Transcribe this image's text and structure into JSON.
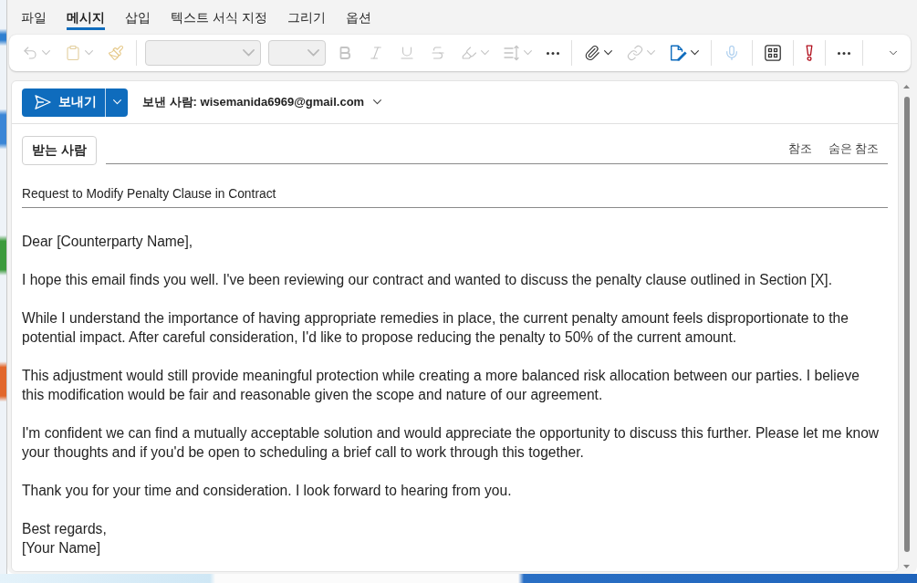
{
  "menu_tabs": [
    {
      "label": "파일",
      "selected": false
    },
    {
      "label": "메시지",
      "selected": true
    },
    {
      "label": "삽입",
      "selected": false
    },
    {
      "label": "텍스트 서식 지정",
      "selected": false
    },
    {
      "label": "그리기",
      "selected": false
    },
    {
      "label": "옵션",
      "selected": false
    }
  ],
  "toolbar": [
    {
      "kind": "undo",
      "disabled": true,
      "dropdown": true
    },
    {
      "kind": "paste",
      "disabled": true,
      "dropdown": true
    },
    {
      "kind": "format-painter",
      "disabled": true
    },
    {
      "kind": "separator"
    },
    {
      "kind": "font-field",
      "disabled": true
    },
    {
      "kind": "size-field",
      "disabled": true
    },
    {
      "kind": "bold",
      "disabled": true
    },
    {
      "kind": "italic",
      "disabled": true
    },
    {
      "kind": "underline",
      "disabled": true
    },
    {
      "kind": "strikethrough",
      "disabled": true
    },
    {
      "kind": "highlight",
      "disabled": true,
      "dropdown": true
    },
    {
      "kind": "line-spacing",
      "disabled": true,
      "dropdown": true
    },
    {
      "kind": "more",
      "disabled": false
    },
    {
      "kind": "separator"
    },
    {
      "kind": "attach",
      "disabled": false,
      "dropdown": true
    },
    {
      "kind": "link",
      "disabled": true,
      "dropdown": true
    },
    {
      "kind": "signature",
      "disabled": false,
      "dropdown": true
    },
    {
      "kind": "separator"
    },
    {
      "kind": "dictate",
      "disabled": true
    },
    {
      "kind": "separator"
    },
    {
      "kind": "apps",
      "disabled": false
    },
    {
      "kind": "separator"
    },
    {
      "kind": "importance",
      "disabled": false
    },
    {
      "kind": "separator"
    },
    {
      "kind": "more",
      "disabled": false
    },
    {
      "kind": "separator"
    },
    {
      "kind": "expand",
      "disabled": false
    }
  ],
  "compose": {
    "send_button": {
      "label": "보내기"
    },
    "from": "보낸 사람: wisemanida6969@gmail.com",
    "to_button": {
      "label": "받는 사람"
    },
    "cc_link": "참조",
    "bcc_link": "숨은 참조",
    "subject": "Request to Modify Penalty Clause in Contract",
    "body": [
      {
        "lines": [
          "Dear [Counterparty Name],"
        ]
      },
      {
        "lines": [
          "I hope this email finds you well. I've been reviewing our contract and wanted to discuss the penalty clause outlined in Section [X]."
        ]
      },
      {
        "lines": [
          "While I understand the importance of having appropriate remedies in place, the current penalty amount feels disproportionate to the",
          "potential impact. After careful consideration, I'd like to propose reducing the penalty to 50% of the current amount."
        ]
      },
      {
        "lines": [
          "This adjustment would still provide meaningful protection while creating a more balanced risk allocation between our parties. I believe",
          "this modification would be fair and reasonable given the scope and nature of our agreement."
        ]
      },
      {
        "lines": [
          "I'm confident we can find a mutually acceptable solution and would appreciate the opportunity to discuss this further. Please let me know",
          "your thoughts and if you'd be open to scheduling a brief call to work through this together."
        ]
      },
      {
        "lines": [
          "Thank you for your time and consideration. I look forward to hearing from you."
        ]
      },
      {
        "lines": [
          "Best regards,",
          "[Your Name]"
        ]
      }
    ]
  }
}
